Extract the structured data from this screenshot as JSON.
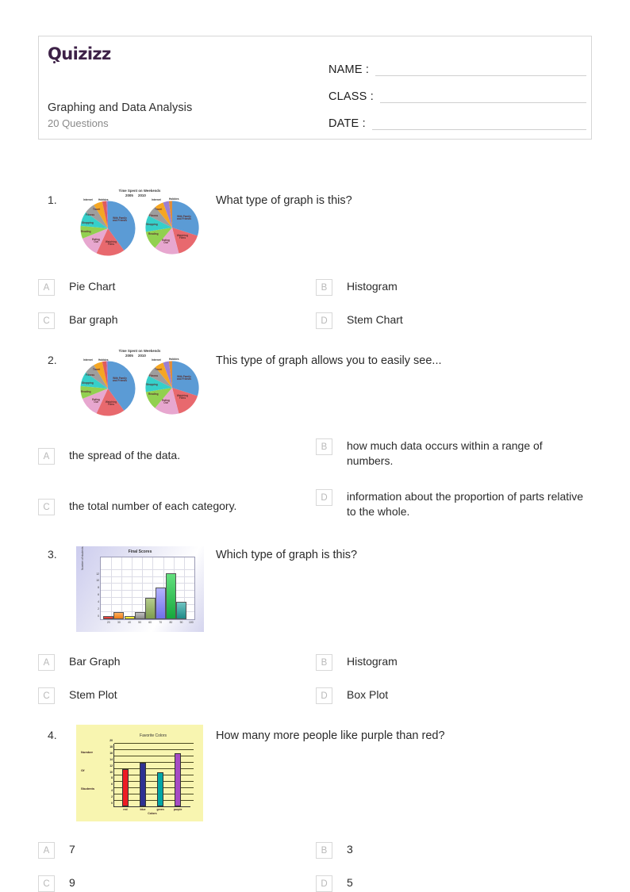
{
  "header": {
    "logo": "Quizizz",
    "title": "Graphing and Data Analysis",
    "subtitle": "20 Questions",
    "fields": [
      {
        "label": "NAME :"
      },
      {
        "label": "CLASS :"
      },
      {
        "label": "DATE  :"
      }
    ]
  },
  "questions": [
    {
      "number": "1.",
      "text": "What type of graph is this?",
      "image": "pie-chart-time-spent-on-weekends",
      "options": [
        {
          "letter": "A",
          "text": "Pie Chart"
        },
        {
          "letter": "B",
          "text": "Histogram"
        },
        {
          "letter": "C",
          "text": "Bar graph"
        },
        {
          "letter": "D",
          "text": "Stem Chart"
        }
      ]
    },
    {
      "number": "2.",
      "text": "This type of graph allows you to easily see...",
      "image": "pie-chart-time-spent-on-weekends",
      "options": [
        {
          "letter": "A",
          "text": "the spread of the data."
        },
        {
          "letter": "B",
          "text": "how much data occurs within a range of numbers."
        },
        {
          "letter": "C",
          "text": "the total number of each category."
        },
        {
          "letter": "D",
          "text": "information about the proportion of parts relative to the whole."
        }
      ]
    },
    {
      "number": "3.",
      "text": "Which type of graph is this?",
      "image": "histogram-final-scores",
      "options": [
        {
          "letter": "A",
          "text": "Bar Graph"
        },
        {
          "letter": "B",
          "text": "Histogram"
        },
        {
          "letter": "C",
          "text": "Stem Plot"
        },
        {
          "letter": "D",
          "text": "Box Plot"
        }
      ]
    },
    {
      "number": "4.",
      "text": "How many more people like purple than red?",
      "image": "bar-chart-favorite-colors",
      "options": [
        {
          "letter": "A",
          "text": "7"
        },
        {
          "letter": "B",
          "text": "3"
        },
        {
          "letter": "C",
          "text": "9"
        },
        {
          "letter": "D",
          "text": "5"
        }
      ]
    }
  ],
  "chart_data": [
    {
      "id": "pie-chart-time-spent-on-weekends",
      "type": "pie",
      "title": "Time Spent on Weekends",
      "panels": [
        {
          "year": "2005",
          "labels": [
            "With Family and Friends",
            "Watching Films",
            "Eating Out",
            "Reading",
            "Shopping",
            "Fitness",
            "Travel",
            "Internet",
            "Hobbies"
          ],
          "values": [
            30,
            17,
            11,
            9,
            9,
            8,
            7,
            5,
            4
          ],
          "colors": [
            "#5b9bd5",
            "#e8696e",
            "#e7a7cf",
            "#92d050",
            "#36cfc9",
            "#9e9e9e",
            "#f5a623",
            "#e05c5c",
            "#9b7fd4"
          ]
        },
        {
          "year": "2010",
          "labels": [
            "With Family and Friends",
            "Watching Films",
            "Eating Out",
            "Reading",
            "Shopping",
            "Fitness",
            "Travel",
            "Internet",
            "Hobbies"
          ],
          "values": [
            25,
            19,
            15,
            11,
            9,
            7,
            6,
            4,
            4
          ],
          "colors": [
            "#5b9bd5",
            "#e8696e",
            "#e7a7cf",
            "#92d050",
            "#36cfc9",
            "#9e9e9e",
            "#f5a623",
            "#9b7fd4",
            "#e08c3a"
          ]
        }
      ]
    },
    {
      "id": "histogram-final-scores",
      "type": "bar",
      "title": "Final Scores",
      "xlabel": "",
      "ylabel": "Number of students",
      "categories": [
        "20",
        "30",
        "40",
        "50",
        "60",
        "70",
        "80",
        "90",
        "100"
      ],
      "values": [
        1,
        2,
        1,
        2,
        6,
        9,
        13,
        5
      ],
      "yticks": [
        "0",
        "2",
        "4",
        "6",
        "8",
        "10",
        "12"
      ],
      "ylim": [
        0,
        14
      ],
      "colors": [
        "#e8251f",
        "#f39023",
        "#f6eb1c",
        "#9a9a9a",
        "#8fae62",
        "#8c8cf0",
        "#2fbd4f",
        "#2f9e9b"
      ]
    },
    {
      "id": "bar-chart-favorite-colors",
      "type": "bar",
      "title": "Favorite Colors",
      "xlabel": "Colors",
      "ylabel": "Number Of Students",
      "categories": [
        "red",
        "blue",
        "green",
        "purple"
      ],
      "values": [
        12,
        14,
        11,
        17
      ],
      "yticks": [
        "0",
        "2",
        "4",
        "6",
        "8",
        "10",
        "12",
        "14",
        "16",
        "18",
        "20"
      ],
      "ylim": [
        0,
        20
      ],
      "colors": [
        "#ed1c24",
        "#2e3192",
        "#00a6a6",
        "#a64bc4"
      ]
    }
  ]
}
